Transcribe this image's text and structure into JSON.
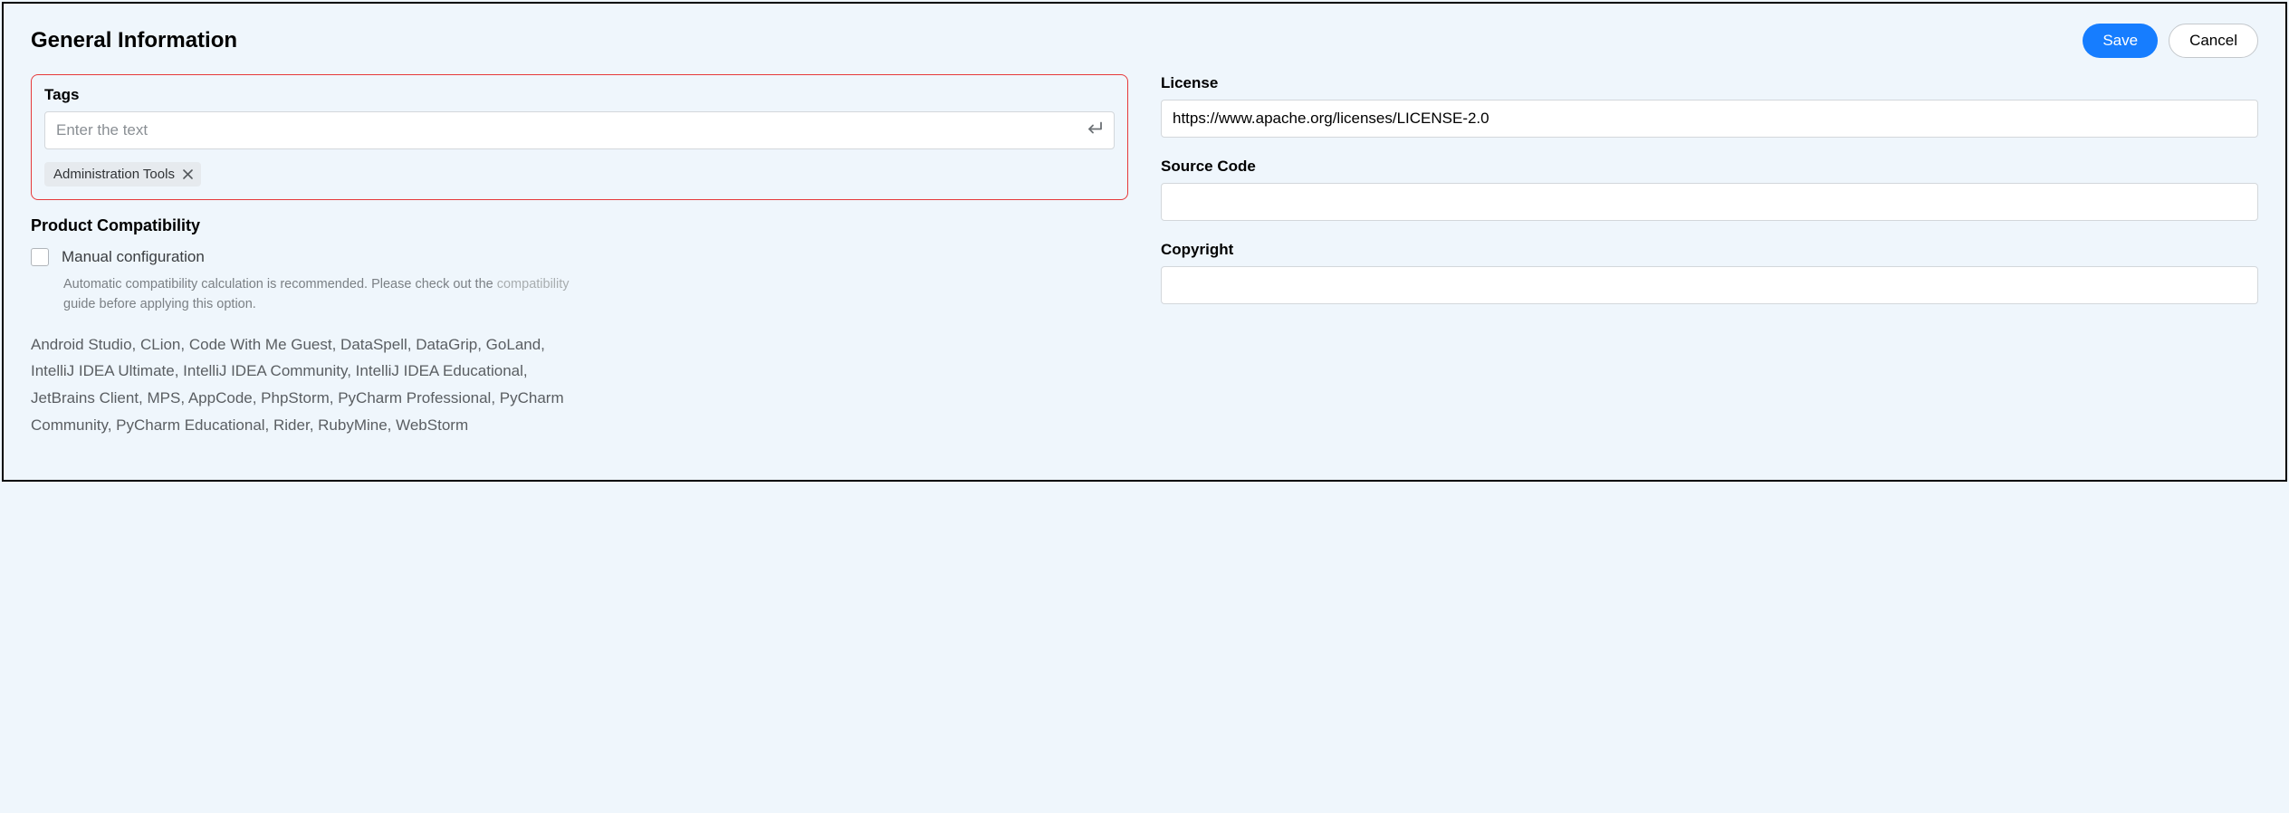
{
  "header": {
    "title": "General Information",
    "save_label": "Save",
    "cancel_label": "Cancel"
  },
  "tags": {
    "label": "Tags",
    "placeholder": "Enter the text",
    "chip": "Administration Tools"
  },
  "compat": {
    "title": "Product Compatibility",
    "checkbox_label": "Manual configuration",
    "help_prefix": "Automatic compatibility calculation is recommended. Please check out the ",
    "help_link": "compatibility",
    "help_suffix": " guide before applying this option.",
    "products": "Android Studio, CLion, Code With Me Guest, DataSpell, DataGrip, GoLand, IntelliJ IDEA Ultimate, IntelliJ IDEA Community, IntelliJ IDEA Educational, JetBrains Client, MPS, AppCode, PhpStorm, PyCharm Professional, PyCharm Community, PyCharm Educational, Rider, RubyMine, WebStorm"
  },
  "license": {
    "label": "License",
    "value": "https://www.apache.org/licenses/LICENSE-2.0"
  },
  "source": {
    "label": "Source Code",
    "value": ""
  },
  "copyright": {
    "label": "Copyright",
    "value": ""
  }
}
